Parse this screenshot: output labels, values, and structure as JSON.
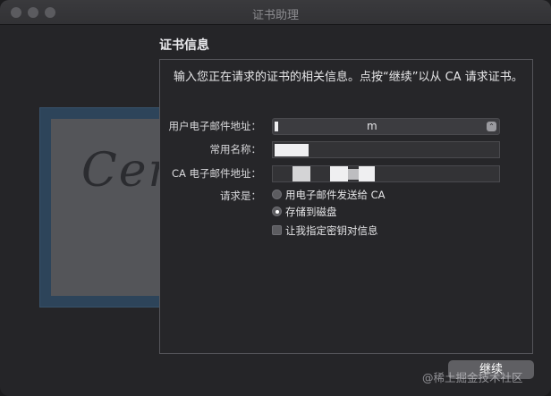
{
  "window": {
    "title": "证书助理"
  },
  "section": {
    "title": "证书信息"
  },
  "intro": "输入您正在请求的证书的相关信息。点按“继续”以从 CA 请求证书。",
  "email": {
    "label": "用户电子邮件地址：",
    "value": "m"
  },
  "common_name": {
    "label": "常用名称：",
    "value": ""
  },
  "ca_email": {
    "label": "CA 电子邮件地址：",
    "value": ""
  },
  "request": {
    "label": "请求是：",
    "options": [
      "用电子邮件发送给 CA",
      "存储到磁盘"
    ],
    "selected": "存储到磁盘"
  },
  "keypair": {
    "label": "让我指定密钥对信息",
    "checked": false
  },
  "continue_label": "继续",
  "watermark": "@稀土掘金技术社区",
  "art": {
    "script_text": "Certif"
  },
  "icons": {
    "select_arrow": "chevron-updown-icon"
  },
  "colors": {
    "background": "#252528",
    "panel_border": "#55555a",
    "button": "#5f5f63"
  }
}
